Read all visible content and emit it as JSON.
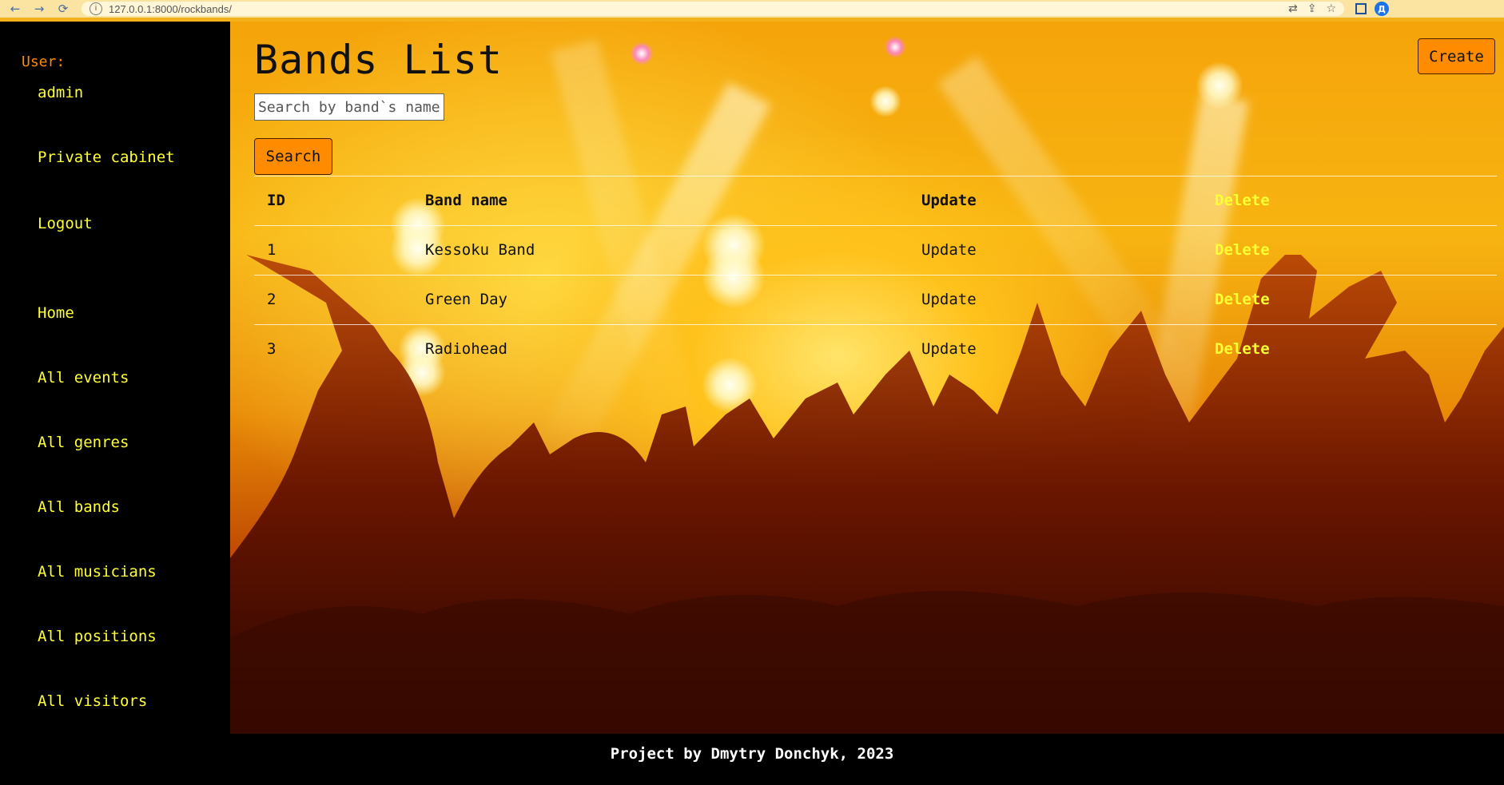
{
  "browser": {
    "url": "127.0.0.1:8000/rockbands/",
    "avatar_letter": "Д"
  },
  "sidebar": {
    "user_label": "User:",
    "username": "admin",
    "account_links": [
      "Private cabinet",
      "Logout"
    ],
    "nav": [
      "Home",
      "All events",
      "All genres",
      "All bands",
      "All musicians",
      "All positions",
      "All visitors"
    ]
  },
  "main": {
    "title": "Bands List",
    "search_placeholder": "Search by band`s name",
    "search_label": "Search",
    "create_label": "Create",
    "table": {
      "headers": [
        "ID",
        "Band name",
        "Update",
        "Delete"
      ],
      "rows": [
        {
          "id": "1",
          "name": "Kessoku Band",
          "update": "Update",
          "delete": "Delete"
        },
        {
          "id": "2",
          "name": "Green Day",
          "update": "Update",
          "delete": "Delete"
        },
        {
          "id": "3",
          "name": "Radiohead",
          "update": "Update",
          "delete": "Delete"
        }
      ]
    }
  },
  "footer": {
    "text": "Project by Dmytry Donchyk, 2023"
  },
  "colors": {
    "accent": "#ff8c00",
    "link": "#ffff33",
    "user_label": "#ff8a00",
    "panel": "#000000"
  }
}
